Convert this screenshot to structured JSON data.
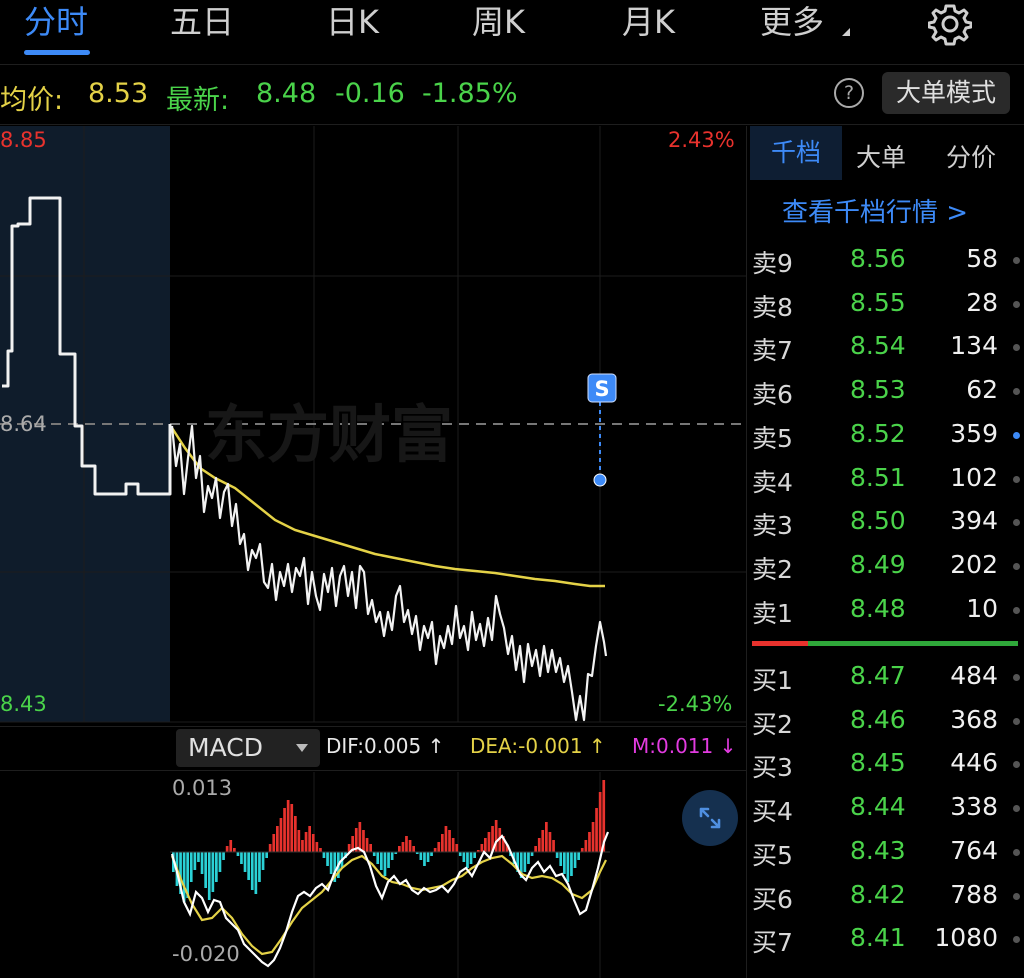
{
  "tabs": [
    "分时",
    "五日",
    "日K",
    "周K",
    "月K",
    "更多"
  ],
  "info": {
    "avg_label": "均价:",
    "avg_value": "8.53",
    "latest_label": "最新:",
    "latest_value": "8.48",
    "change": "-0.16",
    "change_pct": "-1.85%",
    "help_icon": "?",
    "big_order_mode": "大单模式"
  },
  "axis": {
    "price_high": "8.85",
    "price_mid": "8.64",
    "price_low": "8.43",
    "pct_high": "2.43%",
    "pct_low": "-2.43%"
  },
  "watermark": "东方财富",
  "marker": "S",
  "macd": {
    "selector": "MACD",
    "dif": "DIF:0.005 ↑",
    "dea": "DEA:-0.001 ↑",
    "m": "M:0.011 ↓",
    "axis_high": "0.013",
    "axis_low": "-0.020"
  },
  "side": {
    "tabs": [
      "千档",
      "大单",
      "分价"
    ],
    "link": "查看千档行情 >",
    "sells": [
      {
        "label": "卖9",
        "price": "8.56",
        "qty": "58"
      },
      {
        "label": "卖8",
        "price": "8.55",
        "qty": "28"
      },
      {
        "label": "卖7",
        "price": "8.54",
        "qty": "134"
      },
      {
        "label": "卖6",
        "price": "8.53",
        "qty": "62"
      },
      {
        "label": "卖5",
        "price": "8.52",
        "qty": "359"
      },
      {
        "label": "卖4",
        "price": "8.51",
        "qty": "102"
      },
      {
        "label": "卖3",
        "price": "8.50",
        "qty": "394"
      },
      {
        "label": "卖2",
        "price": "8.49",
        "qty": "202"
      },
      {
        "label": "卖1",
        "price": "8.48",
        "qty": "10"
      }
    ],
    "buys": [
      {
        "label": "买1",
        "price": "8.47",
        "qty": "484"
      },
      {
        "label": "买2",
        "price": "8.46",
        "qty": "368"
      },
      {
        "label": "买3",
        "price": "8.45",
        "qty": "446"
      },
      {
        "label": "买4",
        "price": "8.44",
        "qty": "338"
      },
      {
        "label": "买5",
        "price": "8.43",
        "qty": "764"
      },
      {
        "label": "买6",
        "price": "8.42",
        "qty": "788"
      },
      {
        "label": "买7",
        "price": "8.41",
        "qty": "1080"
      }
    ]
  },
  "colors": {
    "up": "#e8322d",
    "down": "#4ad34a",
    "accent": "#3d8af7",
    "avg": "#e4d247",
    "macd_neg": "#2bd1d6",
    "macd_m": "#e23be0"
  }
}
